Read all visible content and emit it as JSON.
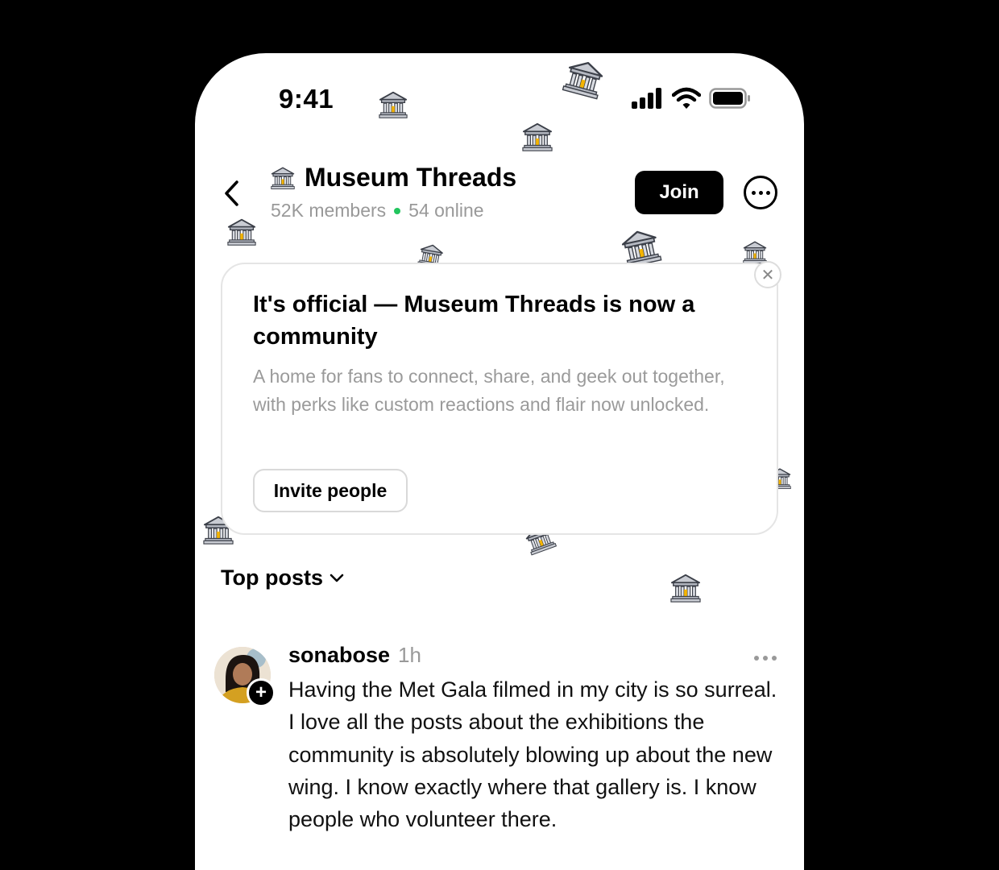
{
  "status_bar": {
    "time": "9:41",
    "icons": [
      "signal-icon",
      "wifi-icon",
      "battery-icon"
    ]
  },
  "header": {
    "back_icon": "chevron-left-icon",
    "community_icon": "museum-icon",
    "title": "Museum Threads",
    "members": "52K members",
    "online": "54 online",
    "online_dot_color": "#22c55e",
    "join_label": "Join",
    "more_icon": "more-circle-icon"
  },
  "announcement": {
    "title": "It's official — Museum Threads is now a community",
    "body": "A home for fans to connect, share, and geek out together, with perks like custom reactions and flair now unlocked.",
    "invite_label": "Invite people",
    "close_icon": "close-icon"
  },
  "feed": {
    "sort_label": "Top posts",
    "sort_icon": "chevron-down-icon",
    "posts": [
      {
        "username": "sonabose",
        "time": "1h",
        "follow_icon": "plus-icon",
        "more_icon": "more-horizontal-icon",
        "text": "Having the Met Gala filmed in my city is so surreal. I love all the posts about the exhibitions the community is absolutely blowing up about the new wing. I know exactly where that gallery is. I know people who volunteer there."
      }
    ]
  },
  "colors": {
    "background": "#000000",
    "surface": "#ffffff",
    "primary_button": "#000000",
    "muted_text": "#999999"
  }
}
